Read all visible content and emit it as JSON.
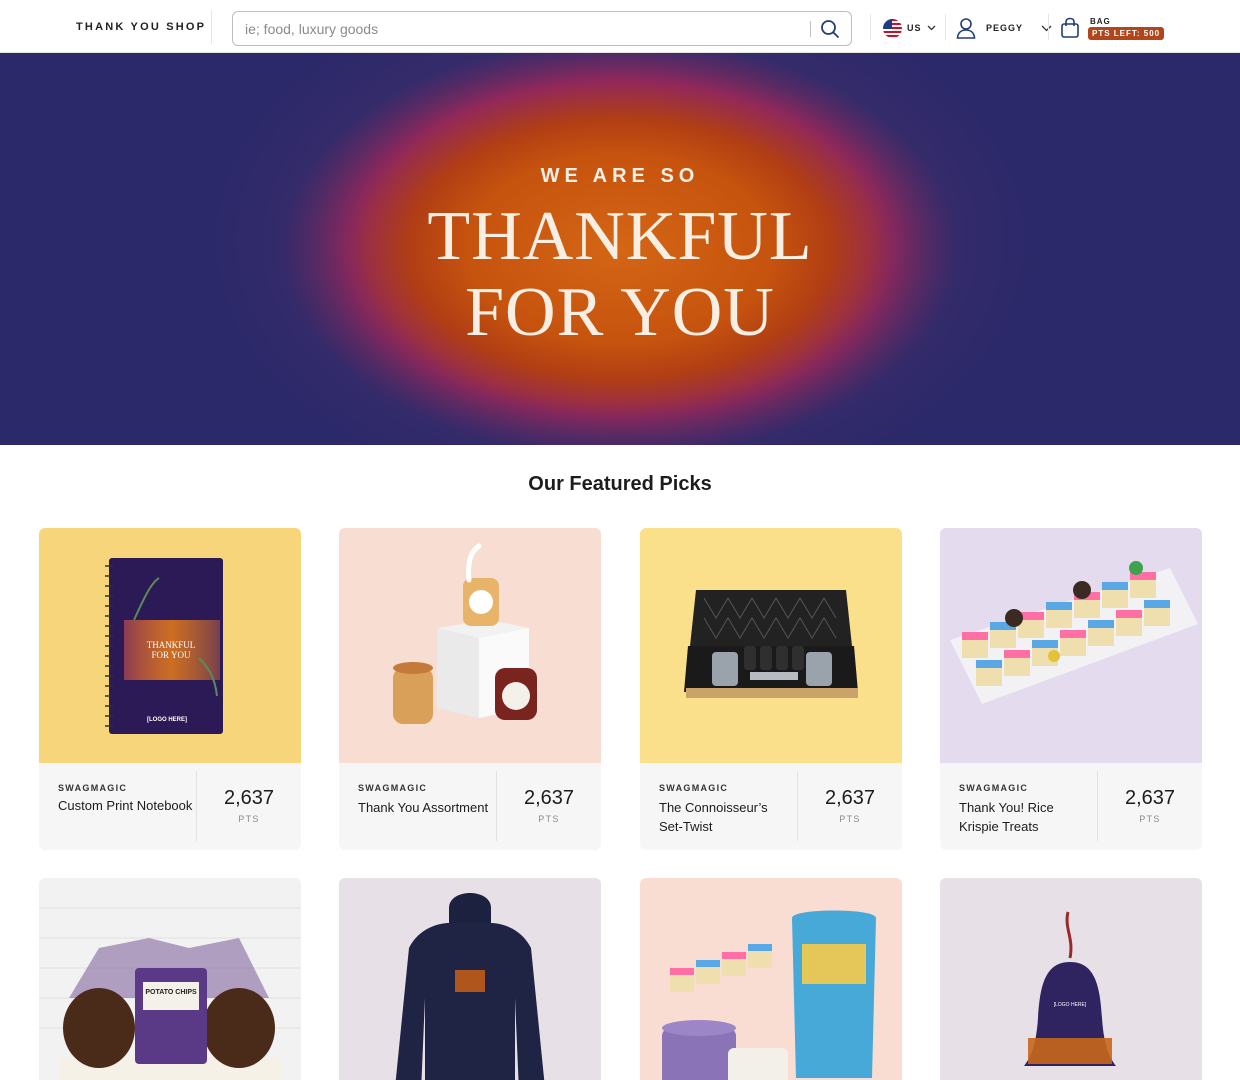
{
  "header": {
    "brand": "THANK YOU SHOP",
    "search_placeholder": "ie; food, luxury goods",
    "locale": "US",
    "user": "PEGGY",
    "bag_label": "BAG",
    "points_left": "PTS LEFT: 500"
  },
  "hero": {
    "kicker": "WE ARE SO",
    "title_line1": "THANKFUL",
    "title_line2": "FOR YOU"
  },
  "featured": {
    "title": "Our Featured Picks",
    "products": [
      {
        "vendor": "SWAGMAGIC",
        "name": "Custom Print Notebook",
        "points": "2,637",
        "unit": "PTS",
        "bg": "#f7d67b"
      },
      {
        "vendor": "SWAGMAGIC",
        "name": "Thank You Assortment",
        "points": "2,637",
        "unit": "PTS",
        "bg": "#f8ddd3"
      },
      {
        "vendor": "SWAGMAGIC",
        "name": "The Connoisseur’s Set-Twist",
        "points": "2,637",
        "unit": "PTS",
        "bg": "#fbe08c"
      },
      {
        "vendor": "SWAGMAGIC",
        "name": "Thank You! Rice Krispie Treats",
        "points": "2,637",
        "unit": "PTS",
        "bg": "#e4dbef"
      }
    ],
    "second_row_bgs": [
      "#f2f2f2",
      "#e7e0e7",
      "#f9ddd3",
      "#e7e0e7"
    ]
  },
  "colors": {
    "accent_badge": "#b0461c",
    "hero_center": "#d46615",
    "hero_edge": "#33306b"
  }
}
